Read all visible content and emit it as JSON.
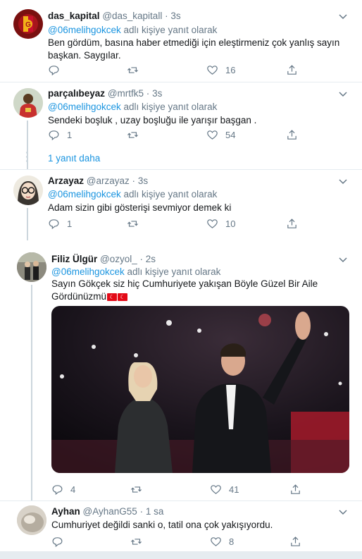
{
  "reply_prefix": "adlı kişiye yanıt olarak",
  "tweets": [
    {
      "name": "das_kapital",
      "handle": "@das_kapitall",
      "time": "3s",
      "mention": "@06melihgokcek",
      "text": "Ben gördüm, basına haber etmediği için eleştirmeniz çok yanlış sayın başkan. Saygılar.",
      "replies": "",
      "retweets": "",
      "likes": "16"
    },
    {
      "name": "parçalıbeyaz",
      "handle": "@mrtfk5",
      "time": "3s",
      "mention": "@06melihgokcek",
      "text": "Sendeki boşluk , uzay boşluğu ile yarışır başgan .",
      "replies": "1",
      "retweets": "",
      "likes": "54"
    },
    {
      "name": "Arzayaz",
      "handle": "@arzayaz",
      "time": "3s",
      "mention": "@06melihgokcek",
      "text": "Adam sizin gibi gösterişi sevmiyor demek ki",
      "replies": "1",
      "retweets": "",
      "likes": "10"
    },
    {
      "name": "Filiz Ülgür",
      "handle": "@ozyol_",
      "time": "2s",
      "mention": "@06melihgokcek",
      "text": "Sayın Gökçek siz hiç Cumhuriyete yakışan Böyle  Güzel Bir Aile Gördünüzmü",
      "replies": "4",
      "retweets": "",
      "likes": "41"
    },
    {
      "name": "Ayhan",
      "handle": "@AyhanG55",
      "time": "1 sa",
      "mention": "",
      "text": "Cumhuriyet değildi sanki o, tatil ona çok yakışıyordu.",
      "replies": "",
      "retweets": "",
      "likes": "8"
    }
  ],
  "more_replies": "1 yanıt daha",
  "flags": [
    "🇹🇷",
    "🇹🇷"
  ],
  "colors": {
    "link": "#1b95e0",
    "muted": "#657786",
    "border": "#e6ecf0",
    "thread": "#ccd6dd"
  }
}
